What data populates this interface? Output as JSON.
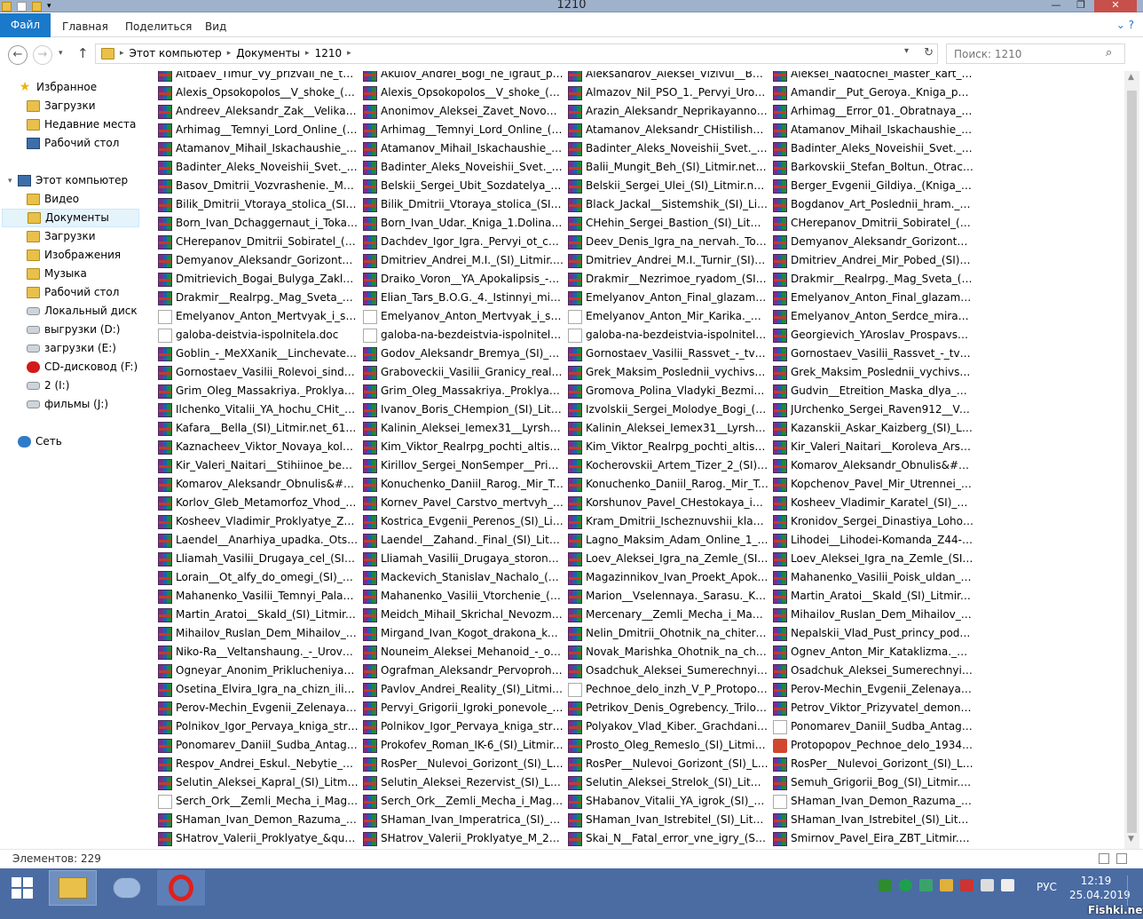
{
  "window": {
    "title": "1210",
    "minimize": "—",
    "maximize": "❐",
    "close": "✕"
  },
  "ribbon": {
    "tabs": [
      "Файл",
      "Главная",
      "Поделиться",
      "Вид"
    ],
    "help": "⌄ ?"
  },
  "address": {
    "crumbs": [
      "Этот компьютер",
      "Документы",
      "1210"
    ]
  },
  "search": {
    "placeholder": "Поиск: 1210"
  },
  "sidebar": {
    "favorites_label": "Избранное",
    "favorites": [
      "Загрузки",
      "Недавние места",
      "Рабочий стол"
    ],
    "computer_label": "Этот компьютер",
    "computer": [
      "Видео",
      "Документы",
      "Загрузки",
      "Изображения",
      "Музыка",
      "Рабочий стол",
      "Локальный диск (C",
      "выгрузки (D:)",
      "загрузки (E:)",
      "CD-дисковод (F:) Co",
      "2 (I:)",
      "фильмы (J:)"
    ],
    "network_label": "Сеть"
  },
  "files": [
    [
      "Altbaev_Timur_Vy_prizvali_ne_togo.....",
      "Akulov_Andrei_Bogi_ne_igraut_po_p...",
      "Aleksandrov_Aleksei_Vizivul__Boevoi...",
      "Aleksei_Nadtochei_Master_kart_(SI)_..."
    ],
    [
      "Alexis_Opsokopolos__V_shoke_(SI)_L...",
      "Alexis_Opsokopolos__V_shoke_(SI)_L...",
      "Almazov_Nil_PSO_1._Pervyi_Uroven_...",
      "Amandir__Put_Geroya._Kniga_perva..."
    ],
    [
      "Andreev_Aleksandr_Zak__Velikaya_Ig...",
      "Anonimov_Aleksei_Zavet_Novogo_...",
      "Arazin_Aleksandr_Neprikayannoe_Pl...",
      "Arhimag__Error_01._Obratnaya_storo..."
    ],
    [
      "Arhimag__Temnyi_Lord_Online_(SI)_...",
      "Arhimag__Temnyi_Lord_Online_(SI)_L...",
      "Atamanov_Aleksandr_CHistilishe_(SI)...",
      "Atamanov_Mihail_Iskachaushie_real..."
    ],
    [
      "Atamanov_Mihail_Iskachaushie_real...",
      "Atamanov_Mihail_Iskachaushie_real...",
      "Badinter_Aleks_Noveishii_Svet._Ingv...",
      "Badinter_Aleks_Noveishii_Svet._Ingv..."
    ],
    [
      "Badinter_Aleks_Noveishii_Svet._Ingv...",
      "Badinter_Aleks_Noveishii_Svet._Ingv...",
      "Balii_Mungit_Beh_(SI)_Litmir.net_621...",
      "Barkovskii_Stefan_Boltun._Otracheni..."
    ],
    [
      "Basov_Dmitrii_Vozvrashenie._Mainkr...",
      "Belskii_Sergei_Ubit_Sozdatelya_(SI)_L...",
      "Belskii_Sergei_Ulei_(SI)_Litmir.net_62...",
      "Berger_Evgenii_Gildiya._(Kniga_1.To..."
    ],
    [
      "Bilik_Dmitrii_Vtoraya_stolica_(SI)_Lit...",
      "Bilik_Dmitrii_Vtoraya_stolica_(SI)_Lit...",
      "Black_Jackal__Sistemshik_(SI)_Litmir...",
      "Bogdanov_Art_Poslednii_hram._Slov..."
    ],
    [
      "Born_Ivan_Dchaggernaut_i_Tokage_(...",
      "Born_Ivan_Udar._Kniga_1.Dolina_Tre...",
      "CHehin_Sergei_Bastion_(SI)_Litmir.n...",
      "CHerepanov_Dmitrii_Sobiratel_(SI)_L..."
    ],
    [
      "CHerepanov_Dmitrii_Sobiratel_(SI)_L...",
      "Dachdev_Igor_Igra._Pervyi_ot_chelov...",
      "Deev_Denis_Igra_na_nervah._Tom_2_...",
      "Demyanov_Aleksandr_Gorizonty_raz..."
    ],
    [
      "Demyanov_Aleksandr_Gorizonty_raz...",
      "Dmitriev_Andrei_M.I._(SI)_Litmir.net_...",
      "Dmitriev_Andrei_M.I._Turnir_(SI)_Lit...",
      "Dmitriev_Andrei_Mir_Pobed_(SI)_Lit..."
    ],
    [
      "Dmitrievich_Bogai_Bulyga_Zakluche...",
      "Draiko_Voron__YA_Apokalipsis_-_Pri...",
      "Drakmir__Nezrimoe_ryadom_(SI)_Lit...",
      "Drakmir__Realrpg._Mag_Sveta_(SI)_Li..."
    ],
    [
      "Drakmir__Realrpg._Mag_Sveta_2_(SI)...",
      "Elian_Tars_B.O.G._4._Istinnyi_mir_(SI)...",
      "Emelyanov_Anton_Final_glazami_Ka...",
      "Emelyanov_Anton_Final_glazami_Ka..."
    ],
    [
      "Emelyanov_Anton_Mertvyak_i_snaip...",
      "Emelyanov_Anton_Mertvyak_i_snaip...",
      "Emelyanov_Anton_Mir_Karika._Nast...",
      "Emelyanov_Anton_Serdce_mira_(SI)_..."
    ],
    [
      "galoba-deistvia-ispolnitela.doc",
      "galoba-na-bezdeistvia-ispolnitela-n...",
      "galoba-na-bezdeistvia-ispolnitela-v-...",
      "Georgievich_YAroslav_Prospavshii_s..."
    ],
    [
      "Goblin_-_MeXXanik__Linchevatel_(SI...",
      "Godov_Aleksandr_Bremya_(SI)_Litmi...",
      "Gornostaev_Vasilii_Rassvet_-_tvoi_vr...",
      "Gornostaev_Vasilii_Rassvet_-_tvoi_vr..."
    ],
    [
      "Gornostaev_Vasilii_Rolevoi_sindrom_...",
      "Graboveckii_Vasilii_Granicy_realnosti...",
      "Grek_Maksim_Poslednii_vychivshii._...",
      "Grek_Maksim_Poslednii_vychivshii._..."
    ],
    [
      "Grim_Oleg_Massakriya._Proklyatyi_(...",
      "Grim_Oleg_Massakriya._Proklyatyi_(...",
      "Gromova_Polina_Vladyki_Bezmirya_(...",
      "Gudvin__Etreition_Maska_dlya_Artist..."
    ],
    [
      "Ilchenko_Vitalii_YA_hochu_CHit_(SI)...",
      "Ivanov_Boris_CHempion_(SI)_Litmir....",
      "Izvolskii_Sergei_Molodye_Bogi_(SI)_L...",
      "JUrchenko_Sergei_Raven912__Volei_..."
    ],
    [
      "Kafara__Bella_(SI)_Litmir.net_613567_...",
      "Kalinin_Aleksei_Iemex31__Lyrshik_(SI...",
      "Kalinin_Aleksei_Iemex31__Lyrshik_(SI...",
      "Kazanskii_Askar_Kaizberg_(SI)_Litmir...."
    ],
    [
      "Kaznacheev_Viktor_Novaya_koloniya...",
      "Kim_Viktor_Realrpg_pochti_altistoriy...",
      "Kim_Viktor_Realrpg_pochti_altistoriy...",
      "Kir_Valeri_Naitari__Koroleva_Arselii_(..."
    ],
    [
      "Kir_Valeri_Naitari__Stihiinoe_bedstvie...",
      "Kirillov_Sergei_NonSemper__Prizvan...",
      "Kocherovskii_Artem_Tizer_2_(SI)_Lit...",
      "Komarov_Aleksandr_Obnulis&#33;_(..."
    ],
    [
      "Komarov_Aleksandr_Obnulis&#33;_(...",
      "Konuchenko_Daniil_Rarog._Mir_Tell...",
      "Konuchenko_Daniil_Rarog._Mir_Tell...",
      "Kopchenov_Pavel_Mir_Utrennei_zvez..."
    ],
    [
      "Korlov_Gleb_Metamorfoz_Vhod_(SI)_...",
      "Kornev_Pavel_Carstvo_mertvyh_Litm...",
      "Korshunov_Pavel_CHestokaya_igra-_...",
      "Kosheev_Vladimir_Karatel_(SI)_Litmir...."
    ],
    [
      "Kosheev_Vladimir_Proklyatye_Zemli_...",
      "Kostrica_Evgenii_Perenos_(SI)_Litmir...",
      "Kram_Dmitrii_Ischeznuvshii_klan_(SI)...",
      "Kronidov_Sergei_Dinastiya_Lohov_(S..."
    ],
    [
      "Laendel__Anarhiya_upadka._Otsev_(...",
      "Laendel__Zahand._Final_(SI)_Litmir.n...",
      "Lagno_Maksim_Adam_Online_1_Abs...",
      "Lihodei__Lihodei-Komanda_Z44-6_(..."
    ],
    [
      "Lliamah_Vasilii_Drugaya_cel_(SI)_Lit...",
      "Lliamah_Vasilii_Drugaya_storona_igr...",
      "Loev_Aleksei_Igra_na_Zemle_(SI)_Lit...",
      "Loev_Aleksei_Igra_na_Zemle_(SI)_Lit..."
    ],
    [
      "Lorain__Ot_alfy_do_omegi_(SI)_Litmi...",
      "Mackevich_Stanislav_Nachalo_(SI)_Li...",
      "Magazinnikov_Ivan_Proekt_Apokalip...",
      "Mahanenko_Vasilii_Poisk_uldan_(SI)_..."
    ],
    [
      "Mahanenko_Vasilii_Temnyi_Paladin....",
      "Mahanenko_Vasilii_Vtorchenie_(SI)_L...",
      "Marion__Vselennaya._Sarasu._Krot_(...",
      "Martin_Aratoi__Skald_(SI)_Litmir.net_..."
    ],
    [
      "Martin_Aratoi__Skald_(SI)_Litmir.net_...",
      "Meidch_Mihail_Skrichal_Nevozmoch...",
      "Mercenary__Zemli_Mecha_i_Magii._...",
      "Mihailov_Ruslan_Dem_Mihailov__Az..."
    ],
    [
      "Mihailov_Ruslan_Dem_Mihailov__Te...",
      "Mirgand_Ivan_Kogot_drakona_kost_...",
      "Nelin_Dmitrii_Ohotnik_na_chiterov_...",
      "Nepalskii_Vlad_Pust_princy_podoch..."
    ],
    [
      "Niko-Ra__Veltanshaung._-_Uroven_per...",
      "Nouneim_Aleksei_Mehanoid_-_onlai...",
      "Novak_Marishka_Ohotnik_na_chiter...",
      "Ognev_Anton_Mir_Kataklizma._Nov..."
    ],
    [
      "Ogneyar_Anonim_Priklucheniya_Og...",
      "Ografman_Aleksandr_Pervoprohode...",
      "Osadchuk_Aleksei_Sumerechnyi_Ob...",
      "Osadchuk_Aleksei_Sumerechnyi_Ob..."
    ],
    [
      "Osetina_Elvira_Igra_na_chizn_ili_Prikl...",
      "Pavlov_Andrei_Reality_(SI)_Litmir.net...",
      "Pechnoe_delo_inzh_V_P_Protopopov...",
      "Perov-Mechin_Evgenii_Zelenaya_kni..."
    ],
    [
      "Perov-Mechin_Evgenii_Zelenaya_kni...",
      "Pervyi_Grigorii_Igroki_ponevole_(SI)_...",
      "Petrikov_Denis_Ogrebency._Trilogiy...",
      "Petrov_Viktor_Prizyvatel_demonov_(..."
    ],
    [
      "Polnikov_Igor_Pervaya_kniga_stranst...",
      "Polnikov_Igor_Pervaya_kniga_stranst...",
      "Polyakov_Vlad_Kiber._Grachdanin_(S...",
      "Ponomarev_Daniil_Sudba_Antagonis..."
    ],
    [
      "Ponomarev_Daniil_Sudba_Antagonis...",
      "Prokofev_Roman_IK-6_(SI)_Litmir.net...",
      "Prosto_Oleg_Remeslo_(SI)_Litmir.net...",
      "Protopopov_Pechnoe_delo_1934.pdf"
    ],
    [
      "Respov_Andrei_Eskul._Nebytie_Varra...",
      "RosPer__Nulevoi_Gorizont_(SI)_Litmi...",
      "RosPer__Nulevoi_Gorizont_(SI)_Litmi...",
      "RosPer__Nulevoi_Gorizont_(SI)_Litmi..."
    ],
    [
      "Selutin_Aleksei_Kapral_(SI)_Litmir.ne...",
      "Selutin_Aleksei_Rezervist_(SI)_Litmir....",
      "Selutin_Aleksei_Strelok_(SI)_Litmir.ne...",
      "Semuh_Grigorii_Bog_(SI)_Litmir.net_..."
    ],
    [
      "Serch_Ork__Zemli_Mecha_i_Magii._S...",
      "Serch_Ork__Zemli_Mecha_i_Magii._Y...",
      "SHabanov_Vitalii_YA_igrok_(SI)_Litm...",
      "SHaman_Ivan_Demon_Razuma_(SI)_..."
    ],
    [
      "SHaman_Ivan_Demon_Razuma_(SI)_...",
      "SHaman_Ivan_Imperatrica_(SI)_Litmi...",
      "SHaman_Ivan_Istrebitel_(SI)_Litmir.n...",
      "SHaman_Ivan_Istrebitel_(SI)_Litmir.n..."
    ],
    [
      "SHatrov_Valerii_Proklyatye_&quotM...",
      "SHatrov_Valerii_Proklyatye_M_2_(SI)...",
      "Skai_N__Fatal_error_vne_igry_(SI)_Lit...",
      "Smirnov_Pavel_Eira_ZBT_Litmir.net_..."
    ]
  ],
  "doc_files": [
    "r13c0",
    "r13c1",
    "r13c2",
    "r14c0",
    "r14c1",
    "r14c2",
    "r33c2",
    "r35c3",
    "r39c0",
    "r39c3"
  ],
  "pdf_files": [
    "r36c3"
  ],
  "status": {
    "items": "Элементов: 229"
  },
  "taskbar": {
    "lang": "РУС",
    "time": "12:19",
    "date": "25.04.2019"
  },
  "watermark": "Fishki.net"
}
